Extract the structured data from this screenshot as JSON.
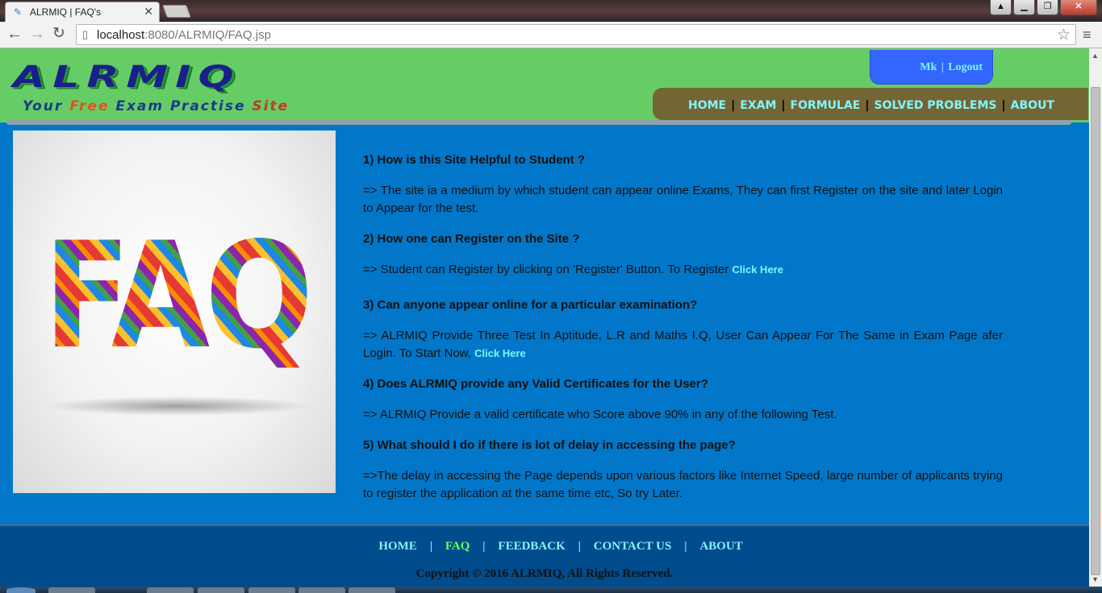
{
  "browser": {
    "tab_title": "ALRMIQ | FAQ's",
    "tab_close": "✕",
    "url_host": "localhost",
    "url_rest": ":8080/ALRMIQ/FAQ.jsp"
  },
  "header": {
    "logo_main": "ALRMIQ",
    "logo_tag_your": "Your ",
    "logo_tag_free": "Free",
    "logo_tag_mid": " Exam Practise ",
    "logo_tag_site": "Site",
    "user_name": "Mk",
    "user_sep": "|",
    "logout": "Logout",
    "nav": {
      "home": "HOME",
      "exam": "EXAM",
      "formulae": "FORMULAE",
      "solved": "SOLVED PROBLEMS",
      "about": "ABOUT",
      "sep": "|"
    }
  },
  "faq_image_text": "FAQ",
  "faqs": [
    {
      "q": "1) How is this Site Helpful to Student ?",
      "a": "=> The site ia a medium by which student can appear online Exams, They can first Register on the site and later Login to Appear for the test."
    },
    {
      "q": "2) How one can Register on the Site ?",
      "a": "=> Student can Register by clicking on 'Register' Button. To Register ",
      "link": "Click Here"
    },
    {
      "q": "3) Can anyone appear online for a particular examination?",
      "a": "=> ALRMIQ Provide Three Test In Aptitude, L.R and Maths I.Q, User Can Appear For The Same in Exam Page afer Login. To Start Now, ",
      "link": "Click Here"
    },
    {
      "q": "4) Does ALRMIQ provide any Valid Certificates for the User?",
      "a": "=> ALRMIQ Provide a valid certificate who Score above 90% in any of the following Test."
    },
    {
      "q": "5) What should I do if there is lot of delay in accessing the page?",
      "a": "=>The delay in accessing the Page depends upon various factors like Internet Speed, large number of applicants trying to register the application at the same time etc, So try Later."
    }
  ],
  "footer": {
    "home": "HOME",
    "faq": "FAQ",
    "feedback": "FEEDBACK",
    "contact": "CONTACT US",
    "about": "ABOUT",
    "sep": "|",
    "copyright": "Copyright © 2016 ALRMIQ, All Rights Reserved."
  },
  "colors": {
    "header_bg": "#66cc66",
    "page_bg": "#0277c9",
    "nav_bg": "#746534",
    "link": "#7ff5ff",
    "footer_bg": "#004c8c",
    "active_footer_link": "#66ff66"
  }
}
